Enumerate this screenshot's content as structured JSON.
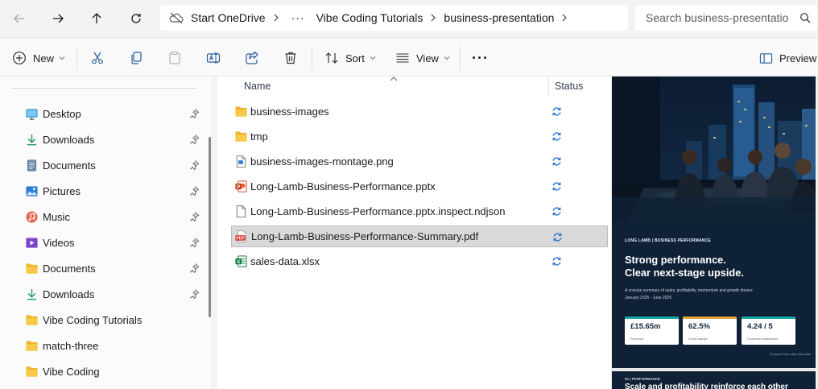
{
  "nav": {
    "breadcrumb": [
      "Start OneDrive",
      "Vibe Coding Tutorials",
      "business-presentation"
    ],
    "breadcrumb_more": "···"
  },
  "search": {
    "placeholder": "Search business-presentatio"
  },
  "toolbar": {
    "new_label": "New",
    "sort_label": "Sort",
    "view_label": "View",
    "more_label": "···",
    "preview_label": "Preview"
  },
  "sidebar": {
    "items": [
      {
        "label": "Desktop",
        "icon": "desktop-icon",
        "pinned": true
      },
      {
        "label": "Downloads",
        "icon": "download-icon",
        "pinned": true
      },
      {
        "label": "Documents",
        "icon": "documents-icon",
        "pinned": true
      },
      {
        "label": "Pictures",
        "icon": "pictures-icon",
        "pinned": true
      },
      {
        "label": "Music",
        "icon": "music-icon",
        "pinned": true
      },
      {
        "label": "Videos",
        "icon": "videos-icon",
        "pinned": true
      },
      {
        "label": "Documents",
        "icon": "folder-icon",
        "pinned": true
      },
      {
        "label": "Downloads",
        "icon": "download-icon",
        "pinned": true
      },
      {
        "label": "Vibe Coding Tutorials",
        "icon": "folder-icon",
        "pinned": false
      },
      {
        "label": "match-three",
        "icon": "folder-icon",
        "pinned": false
      },
      {
        "label": "Vibe Coding",
        "icon": "folder-icon",
        "pinned": false
      }
    ]
  },
  "files": {
    "columns": {
      "name": "Name",
      "status": "Status"
    },
    "rows": [
      {
        "name": "business-images",
        "type": "folder",
        "status": "sync-icon",
        "selected": false
      },
      {
        "name": "tmp",
        "type": "folder",
        "status": "sync-icon",
        "selected": false
      },
      {
        "name": "business-images-montage.png",
        "type": "image",
        "status": "sync-icon",
        "selected": false
      },
      {
        "name": "Long-Lamb-Business-Performance.pptx",
        "type": "pptx",
        "status": "sync-icon",
        "selected": false
      },
      {
        "name": "Long-Lamb-Business-Performance.pptx.inspect.ndjson",
        "type": "text",
        "status": "sync-icon",
        "selected": false
      },
      {
        "name": "Long-Lamb-Business-Performance-Summary.pdf",
        "type": "pdf",
        "status": "sync-icon",
        "selected": true
      },
      {
        "name": "sales-data.xlsx",
        "type": "xlsx",
        "status": "sync-icon",
        "selected": false
      }
    ]
  },
  "preview": {
    "slide1": {
      "kicker": "LONG LAMB | BUSINESS PERFORMANCE",
      "headline_1": "Strong performance.",
      "headline_2": "Clear next-stage upside.",
      "description": "A concise summary of sales, profitability, momentum and growth drivers",
      "date_range": "January 2025 - June 2026",
      "kpis": [
        {
          "value": "£15.65m",
          "label": "Revenue",
          "color": "#14a8a0"
        },
        {
          "value": "62.5%",
          "label": "Gross margin",
          "color": "#e0a63a"
        },
        {
          "value": "4.24 / 5",
          "label": "Customer satisfaction",
          "color": "#14a8a0"
        }
      ],
      "footer": "Prepared from sales data data"
    },
    "slide2": {
      "kicker": "01 | PERFORMANCE",
      "headline": "Scale and profitability reinforce each other"
    }
  },
  "colors": {
    "accent": "#0067c0",
    "folder": "#f4c54d",
    "selected_row": "#d9d9d9",
    "slide_background": "#0f2136"
  }
}
